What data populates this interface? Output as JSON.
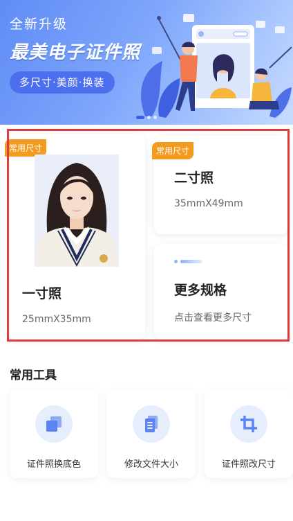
{
  "banner": {
    "subtitle": "全新升级",
    "headline": "最美电子证件照",
    "pill": "多尺寸·美颜·换装"
  },
  "cards": [
    {
      "tag": "常用尺寸",
      "title": "一寸照",
      "size": "25mmX35mm"
    },
    {
      "tag": "常用尺寸",
      "title": "二寸照",
      "size": "35mmX49mm"
    },
    {
      "title": "更多规格",
      "size": "点击查看更多尺寸"
    }
  ],
  "tools_section": {
    "title": "常用工具",
    "items": [
      {
        "label": "证件照换底色",
        "icon": "change-background-icon"
      },
      {
        "label": "修改文件大小",
        "icon": "file-size-icon"
      },
      {
        "label": "证件照改尺寸",
        "icon": "crop-icon"
      }
    ]
  },
  "colors": {
    "accent": "#4c6ff0",
    "tag": "#f39b1e",
    "highlight_border": "#e03a3a",
    "icon_blue": "#5b84f3"
  }
}
